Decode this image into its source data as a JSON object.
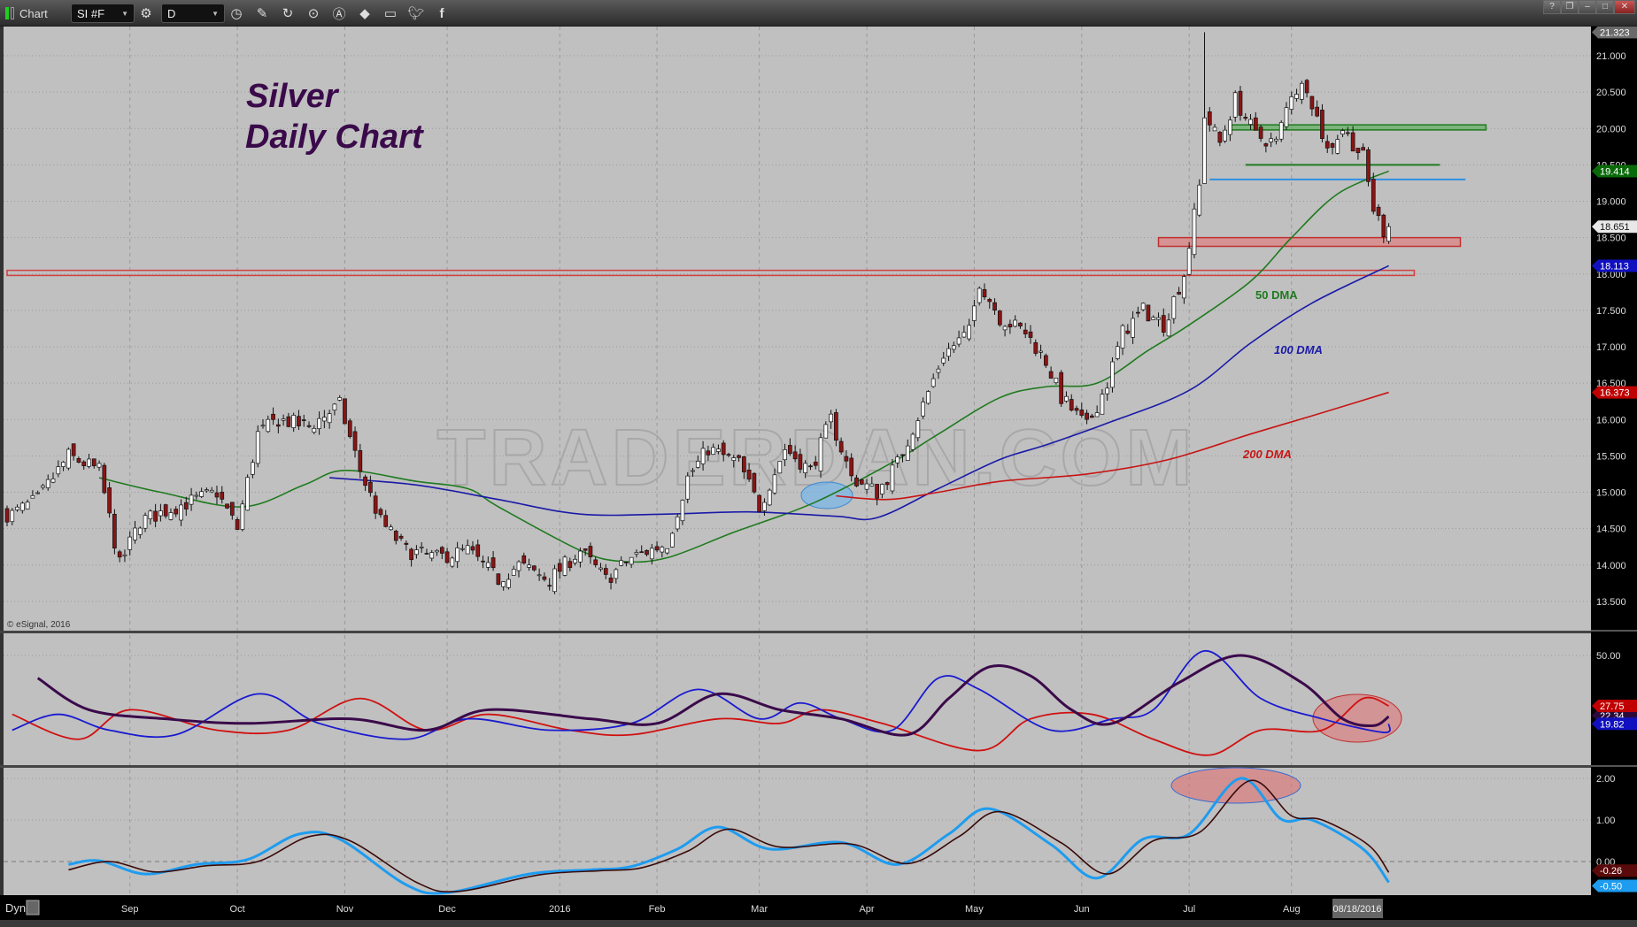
{
  "toolbar": {
    "title": "Chart",
    "symbol": "SI #F",
    "interval": "D",
    "icons": [
      "gear-icon",
      "clock-icon",
      "pencil-icon",
      "refresh-icon",
      "play-icon",
      "alert-icon",
      "eraser-icon",
      "comment-icon",
      "twitter-icon",
      "facebook-icon"
    ]
  },
  "window_buttons": [
    "?",
    "❐",
    "–",
    "□",
    "✕"
  ],
  "annotations": {
    "title_line1": "Silver",
    "title_line2": "Daily Chart",
    "dma50": "50 DMA",
    "dma100": "100 DMA",
    "dma200": "200 DMA",
    "watermark": "TRADERDAN.COM",
    "copyright": "© eSignal, 2016"
  },
  "status": {
    "dyn": "Dyn"
  },
  "colors": {
    "bg": "#c0c0c0",
    "up": "#ffffff",
    "down": "#8b1414",
    "ma50": "#1f7a1f",
    "ma100": "#1a1aa8",
    "ma200": "#c81414",
    "osc_purple": "#3a0a4a",
    "osc_blue": "#1a1ad0",
    "osc_red": "#d01010",
    "macd_light": "#1e9cf0",
    "macd_dark": "#3a0a0a"
  },
  "chart_data": {
    "type": "candlestick",
    "title": "Silver Daily Chart",
    "ylim": [
      13.2,
      21.4
    ],
    "x_days": 270,
    "x_ticks": [
      {
        "label": "Sep",
        "day": 24
      },
      {
        "label": "Oct",
        "day": 45
      },
      {
        "label": "Nov",
        "day": 66
      },
      {
        "label": "Dec",
        "day": 86
      },
      {
        "label": "2016",
        "day": 108
      },
      {
        "label": "Feb",
        "day": 127
      },
      {
        "label": "Mar",
        "day": 147
      },
      {
        "label": "Apr",
        "day": 168
      },
      {
        "label": "May",
        "day": 189
      },
      {
        "label": "Jun",
        "day": 210
      },
      {
        "label": "Jul",
        "day": 231
      },
      {
        "label": "Aug",
        "day": 251
      }
    ],
    "current_date": "08/18/2016",
    "y_ticks": [
      "13.500",
      "14.000",
      "14.500",
      "15.000",
      "15.500",
      "16.000",
      "16.500",
      "17.000",
      "17.500",
      "18.000",
      "18.500",
      "19.000",
      "19.500",
      "20.000",
      "20.500",
      "21.000"
    ],
    "price_labels": [
      {
        "text": "21.323",
        "value": 21.323,
        "color": "#6a6a6a"
      },
      {
        "text": "19.414",
        "value": 19.414,
        "color": "#0a6a0a"
      },
      {
        "text": "18.651",
        "value": 18.651,
        "color": "#e8e8e8"
      },
      {
        "text": "18.113",
        "value": 18.113,
        "color": "#1010c0"
      },
      {
        "text": "16.373",
        "value": 16.373,
        "color": "#c00000"
      }
    ],
    "close_keypoints": [
      [
        1,
        14.7
      ],
      [
        6,
        14.9
      ],
      [
        12,
        15.5
      ],
      [
        18,
        15.3
      ],
      [
        22,
        14.0
      ],
      [
        26,
        14.6
      ],
      [
        33,
        14.8
      ],
      [
        37,
        14.9
      ],
      [
        41,
        15.0
      ],
      [
        45,
        14.5
      ],
      [
        49,
        15.8
      ],
      [
        53,
        16.0
      ],
      [
        59,
        15.9
      ],
      [
        65,
        16.2
      ],
      [
        69,
        15.3
      ],
      [
        73,
        14.6
      ],
      [
        78,
        14.2
      ],
      [
        84,
        14.1
      ],
      [
        90,
        14.2
      ],
      [
        96,
        13.8
      ],
      [
        100,
        14.0
      ],
      [
        106,
        13.8
      ],
      [
        112,
        14.2
      ],
      [
        117,
        13.8
      ],
      [
        122,
        14.1
      ],
      [
        129,
        14.3
      ],
      [
        133,
        15.2
      ],
      [
        137,
        15.6
      ],
      [
        143,
        15.4
      ],
      [
        147,
        14.8
      ],
      [
        152,
        15.6
      ],
      [
        157,
        15.3
      ],
      [
        161,
        16.0
      ],
      [
        165,
        15.2
      ],
      [
        170,
        15.0
      ],
      [
        174,
        15.4
      ],
      [
        179,
        16.2
      ],
      [
        183,
        16.9
      ],
      [
        188,
        17.2
      ],
      [
        190,
        17.9
      ],
      [
        194,
        17.4
      ],
      [
        199,
        17.2
      ],
      [
        203,
        16.8
      ],
      [
        206,
        16.3
      ],
      [
        211,
        15.9
      ],
      [
        215,
        16.5
      ],
      [
        218,
        17.2
      ],
      [
        222,
        17.5
      ],
      [
        226,
        17.3
      ],
      [
        230,
        18.0
      ],
      [
        233,
        19.2
      ],
      [
        234,
        20.2
      ],
      [
        237,
        19.8
      ],
      [
        240,
        20.4
      ],
      [
        244,
        19.9
      ],
      [
        248,
        19.8
      ],
      [
        251,
        20.5
      ],
      [
        254,
        20.6
      ],
      [
        258,
        19.7
      ],
      [
        261,
        20.0
      ],
      [
        265,
        19.6
      ],
      [
        267,
        18.9
      ],
      [
        269,
        18.6
      ],
      [
        270,
        18.651
      ]
    ],
    "extremes": [
      {
        "day": 234,
        "high": 21.323
      }
    ],
    "ma50": [
      [
        18,
        15.2
      ],
      [
        30,
        15.0
      ],
      [
        46,
        14.8
      ],
      [
        58,
        15.1
      ],
      [
        66,
        15.3
      ],
      [
        80,
        15.15
      ],
      [
        90,
        15.05
      ],
      [
        96,
        14.8
      ],
      [
        112,
        14.2
      ],
      [
        120,
        14.05
      ],
      [
        129,
        14.1
      ],
      [
        142,
        14.45
      ],
      [
        154,
        14.75
      ],
      [
        162,
        15.0
      ],
      [
        174,
        15.45
      ],
      [
        182,
        15.8
      ],
      [
        194,
        16.3
      ],
      [
        203,
        16.45
      ],
      [
        213,
        16.5
      ],
      [
        223,
        16.95
      ],
      [
        231,
        17.3
      ],
      [
        243,
        17.9
      ],
      [
        251,
        18.5
      ],
      [
        260,
        19.1
      ],
      [
        270,
        19.414
      ]
    ],
    "ma100": [
      [
        63,
        15.2
      ],
      [
        80,
        15.1
      ],
      [
        96,
        14.9
      ],
      [
        112,
        14.7
      ],
      [
        129,
        14.7
      ],
      [
        145,
        14.73
      ],
      [
        162,
        14.67
      ],
      [
        170,
        14.65
      ],
      [
        182,
        15.05
      ],
      [
        194,
        15.45
      ],
      [
        203,
        15.65
      ],
      [
        215,
        15.95
      ],
      [
        231,
        16.4
      ],
      [
        243,
        17.05
      ],
      [
        255,
        17.6
      ],
      [
        270,
        18.113
      ]
    ],
    "ma200": [
      [
        162,
        14.95
      ],
      [
        172,
        14.9
      ],
      [
        182,
        15.0
      ],
      [
        194,
        15.15
      ],
      [
        211,
        15.25
      ],
      [
        227,
        15.45
      ],
      [
        243,
        15.8
      ],
      [
        255,
        16.05
      ],
      [
        270,
        16.373
      ]
    ],
    "levels": [
      {
        "from": 0,
        "to": 275,
        "top": 18.05,
        "bottom": 17.98,
        "color": "#d04040",
        "fill": "none"
      },
      {
        "from": 225,
        "to": 284,
        "top": 18.5,
        "bottom": 18.38,
        "color": "#c03030",
        "fill": "#e08080"
      },
      {
        "from": 239,
        "to": 289,
        "top": 20.05,
        "bottom": 19.98,
        "color": "#207a20",
        "fill": "#60b060"
      },
      {
        "from": 242,
        "to": 280,
        "top": 19.5,
        "bottom": 19.5,
        "color": "#207a20",
        "fill": "none"
      },
      {
        "from": 235,
        "to": 285,
        "top": 19.3,
        "bottom": 19.3,
        "color": "#3090e0",
        "fill": "none"
      }
    ],
    "oscillator1": {
      "y_ticks": [
        "50.00"
      ],
      "labels": [
        {
          "text": "27.75",
          "color": "#c00000",
          "value": 27.75
        },
        {
          "text": "22.34",
          "color": "#2a0a3a",
          "value": 23.5
        },
        {
          "text": "19.82",
          "color": "#1010c0",
          "value": 19.82
        }
      ],
      "purple": [
        [
          6,
          40
        ],
        [
          16,
          26
        ],
        [
          31,
          22
        ],
        [
          47,
          20
        ],
        [
          67,
          22
        ],
        [
          82,
          17
        ],
        [
          94,
          26
        ],
        [
          114,
          22
        ],
        [
          127,
          20
        ],
        [
          139,
          33
        ],
        [
          151,
          26
        ],
        [
          163,
          22
        ],
        [
          176,
          15
        ],
        [
          184,
          31
        ],
        [
          192,
          45
        ],
        [
          200,
          41
        ],
        [
          208,
          26
        ],
        [
          216,
          20
        ],
        [
          229,
          38
        ],
        [
          241,
          50
        ],
        [
          253,
          38
        ],
        [
          261,
          22
        ],
        [
          267,
          19
        ],
        [
          270,
          23
        ]
      ],
      "blue": [
        [
          1,
          17
        ],
        [
          10,
          24
        ],
        [
          20,
          17
        ],
        [
          33,
          15
        ],
        [
          49,
          33
        ],
        [
          61,
          20
        ],
        [
          78,
          13
        ],
        [
          90,
          22
        ],
        [
          106,
          17
        ],
        [
          122,
          20
        ],
        [
          135,
          35
        ],
        [
          147,
          22
        ],
        [
          155,
          29
        ],
        [
          163,
          22
        ],
        [
          173,
          17
        ],
        [
          182,
          40
        ],
        [
          190,
          35
        ],
        [
          204,
          17
        ],
        [
          216,
          22
        ],
        [
          224,
          26
        ],
        [
          234,
          52
        ],
        [
          245,
          31
        ],
        [
          257,
          22
        ],
        [
          269,
          16
        ],
        [
          270,
          19.82
        ]
      ],
      "red": [
        [
          1,
          24
        ],
        [
          14,
          13
        ],
        [
          24,
          26
        ],
        [
          41,
          17
        ],
        [
          55,
          17
        ],
        [
          69,
          31
        ],
        [
          82,
          17
        ],
        [
          94,
          24
        ],
        [
          110,
          17
        ],
        [
          122,
          15
        ],
        [
          139,
          22
        ],
        [
          151,
          20
        ],
        [
          159,
          26
        ],
        [
          171,
          20
        ],
        [
          190,
          8
        ],
        [
          200,
          22
        ],
        [
          212,
          24
        ],
        [
          224,
          13
        ],
        [
          235,
          6
        ],
        [
          245,
          17
        ],
        [
          257,
          17
        ],
        [
          265,
          31
        ],
        [
          270,
          27.75
        ]
      ]
    },
    "oscillator2": {
      "y_ticks": [
        "2.00",
        "1.00",
        "0.00"
      ],
      "labels": [
        {
          "text": "-0.26",
          "color": "#5a0a0a",
          "value": -0.26
        },
        {
          "text": "-0.50",
          "color": "#1e9cf0",
          "value": -0.5
        }
      ],
      "light": [
        [
          12,
          -0.07
        ],
        [
          18,
          0.02
        ],
        [
          27,
          -0.3
        ],
        [
          37,
          -0.07
        ],
        [
          47,
          0.05
        ],
        [
          57,
          0.66
        ],
        [
          65,
          0.54
        ],
        [
          78,
          -0.56
        ],
        [
          86,
          -0.75
        ],
        [
          102,
          -0.3
        ],
        [
          114,
          -0.2
        ],
        [
          122,
          -0.12
        ],
        [
          131,
          0.3
        ],
        [
          139,
          0.83
        ],
        [
          149,
          0.3
        ],
        [
          163,
          0.46
        ],
        [
          174,
          -0.07
        ],
        [
          184,
          0.66
        ],
        [
          192,
          1.27
        ],
        [
          204,
          0.41
        ],
        [
          213,
          -0.4
        ],
        [
          222,
          0.54
        ],
        [
          231,
          0.66
        ],
        [
          241,
          2.0
        ],
        [
          249,
          1.02
        ],
        [
          255,
          1.0
        ],
        [
          265,
          0.3
        ],
        [
          270,
          -0.5
        ]
      ],
      "dark": [
        [
          12,
          -0.2
        ],
        [
          20,
          0.0
        ],
        [
          29,
          -0.25
        ],
        [
          39,
          -0.1
        ],
        [
          49,
          0.0
        ],
        [
          59,
          0.6
        ],
        [
          67,
          0.5
        ],
        [
          80,
          -0.5
        ],
        [
          88,
          -0.72
        ],
        [
          104,
          -0.32
        ],
        [
          116,
          -0.22
        ],
        [
          124,
          -0.15
        ],
        [
          133,
          0.25
        ],
        [
          141,
          0.78
        ],
        [
          151,
          0.35
        ],
        [
          165,
          0.42
        ],
        [
          176,
          -0.05
        ],
        [
          186,
          0.6
        ],
        [
          194,
          1.2
        ],
        [
          206,
          0.45
        ],
        [
          215,
          -0.3
        ],
        [
          224,
          0.5
        ],
        [
          233,
          0.7
        ],
        [
          243,
          1.95
        ],
        [
          251,
          1.1
        ],
        [
          257,
          1.0
        ],
        [
          266,
          0.4
        ],
        [
          270,
          -0.26
        ]
      ]
    }
  }
}
